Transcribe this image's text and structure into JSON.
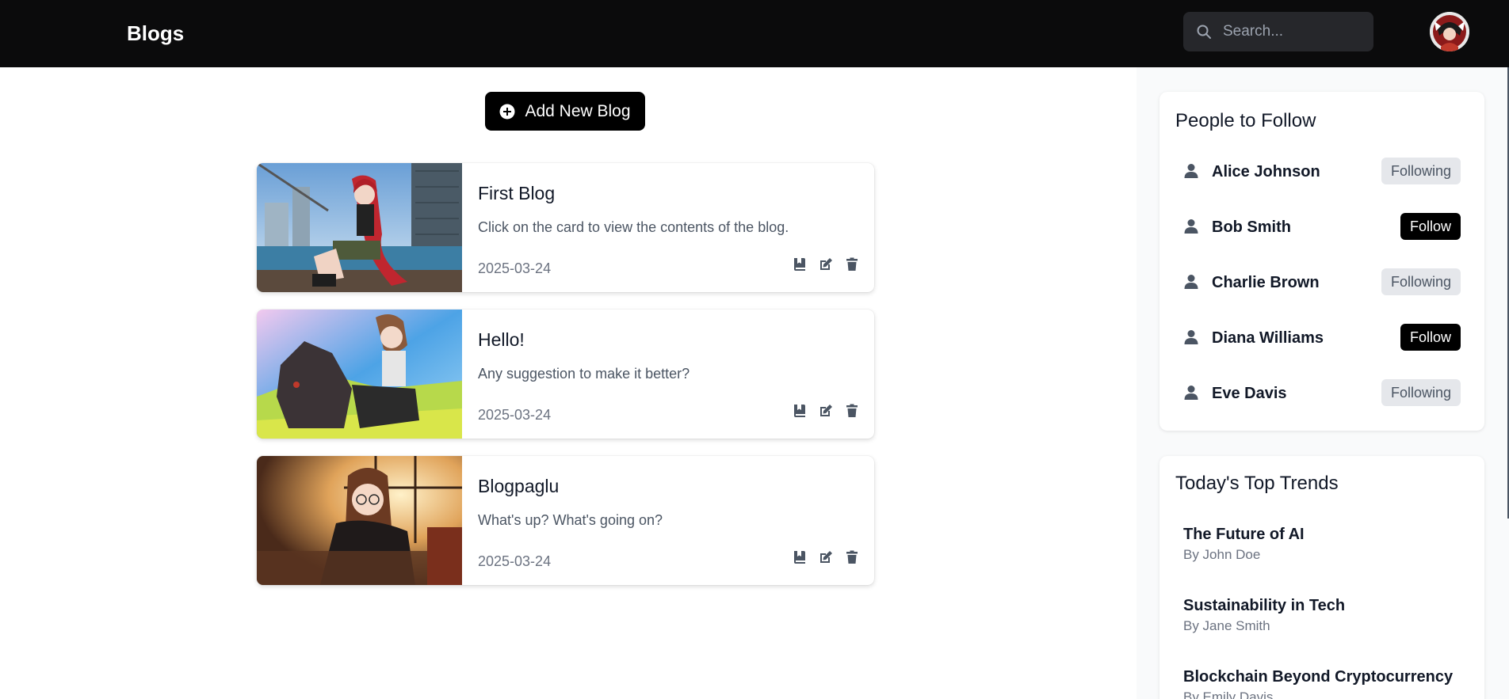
{
  "header": {
    "brand": "Blogs",
    "search_placeholder": "Search...",
    "search_value": ""
  },
  "main": {
    "add_button_label": "Add New Blog",
    "blogs": [
      {
        "title": "First Blog",
        "description": "Click on the card to view the contents of the blog.",
        "date": "2025-03-24"
      },
      {
        "title": "Hello!",
        "description": "Any suggestion to make it better?",
        "date": "2025-03-24"
      },
      {
        "title": "Blogpaglu",
        "description": "What's up? What's going on?",
        "date": "2025-03-24"
      }
    ]
  },
  "sidebar": {
    "people_title": "People to Follow",
    "people": [
      {
        "name": "Alice Johnson",
        "status": "Following"
      },
      {
        "name": "Bob Smith",
        "status": "Follow"
      },
      {
        "name": "Charlie Brown",
        "status": "Following"
      },
      {
        "name": "Diana Williams",
        "status": "Follow"
      },
      {
        "name": "Eve Davis",
        "status": "Following"
      }
    ],
    "trends_title": "Today's Top Trends",
    "trends": [
      {
        "title": "The Future of AI",
        "author": "By John Doe"
      },
      {
        "title": "Sustainability in Tech",
        "author": "By Jane Smith"
      },
      {
        "title": "Blockchain Beyond Cryptocurrency",
        "author": "By Emily Davis"
      }
    ]
  },
  "colors": {
    "header_bg": "#0b0b0c",
    "primary": "#000000",
    "muted_text": "#6b7280",
    "following_bg": "#e5e7eb"
  },
  "icons": {
    "search": "search-icon",
    "add": "plus-circle-icon",
    "save": "bookmark-icon",
    "edit": "edit-icon",
    "delete": "trash-icon",
    "person": "user-icon"
  }
}
